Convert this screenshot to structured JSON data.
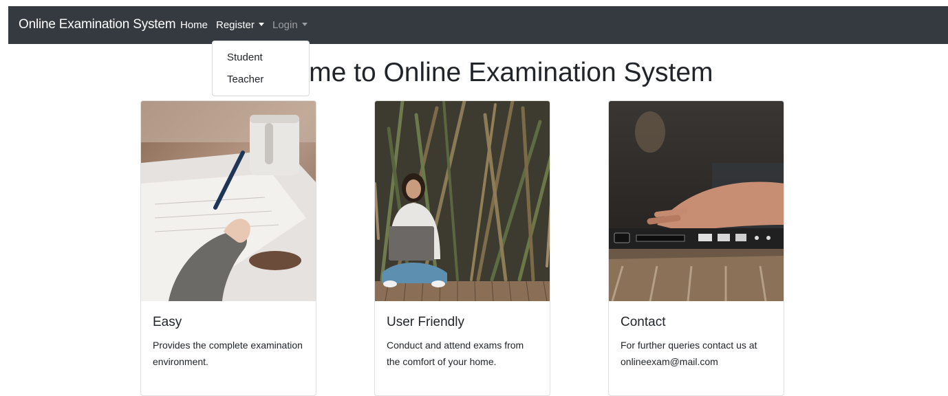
{
  "navbar": {
    "brand": "Online Examination System",
    "items": [
      {
        "label": "Home"
      },
      {
        "label": "Register"
      },
      {
        "label": "Login"
      }
    ]
  },
  "dropdown": {
    "items": [
      {
        "label": "Student"
      },
      {
        "label": "Teacher"
      }
    ]
  },
  "heading": "Welcome to Online Examination System",
  "cards": [
    {
      "title": "Easy",
      "text": "Provides the complete examination environment.",
      "image": "writing-on-paper-photo"
    },
    {
      "title": "User Friendly",
      "text": "Conduct and attend exams from the comfort of your home.",
      "image": "woman-with-laptop-photo"
    },
    {
      "title": "Contact",
      "text": "For further queries contact us at onlineexam@mail.com",
      "image": "typing-on-laptop-photo"
    }
  ],
  "colors": {
    "navbar_bg": "#343a40",
    "nav_active": "#ffffff",
    "nav_muted": "rgba(255,255,255,0.5)",
    "text": "#212529"
  }
}
